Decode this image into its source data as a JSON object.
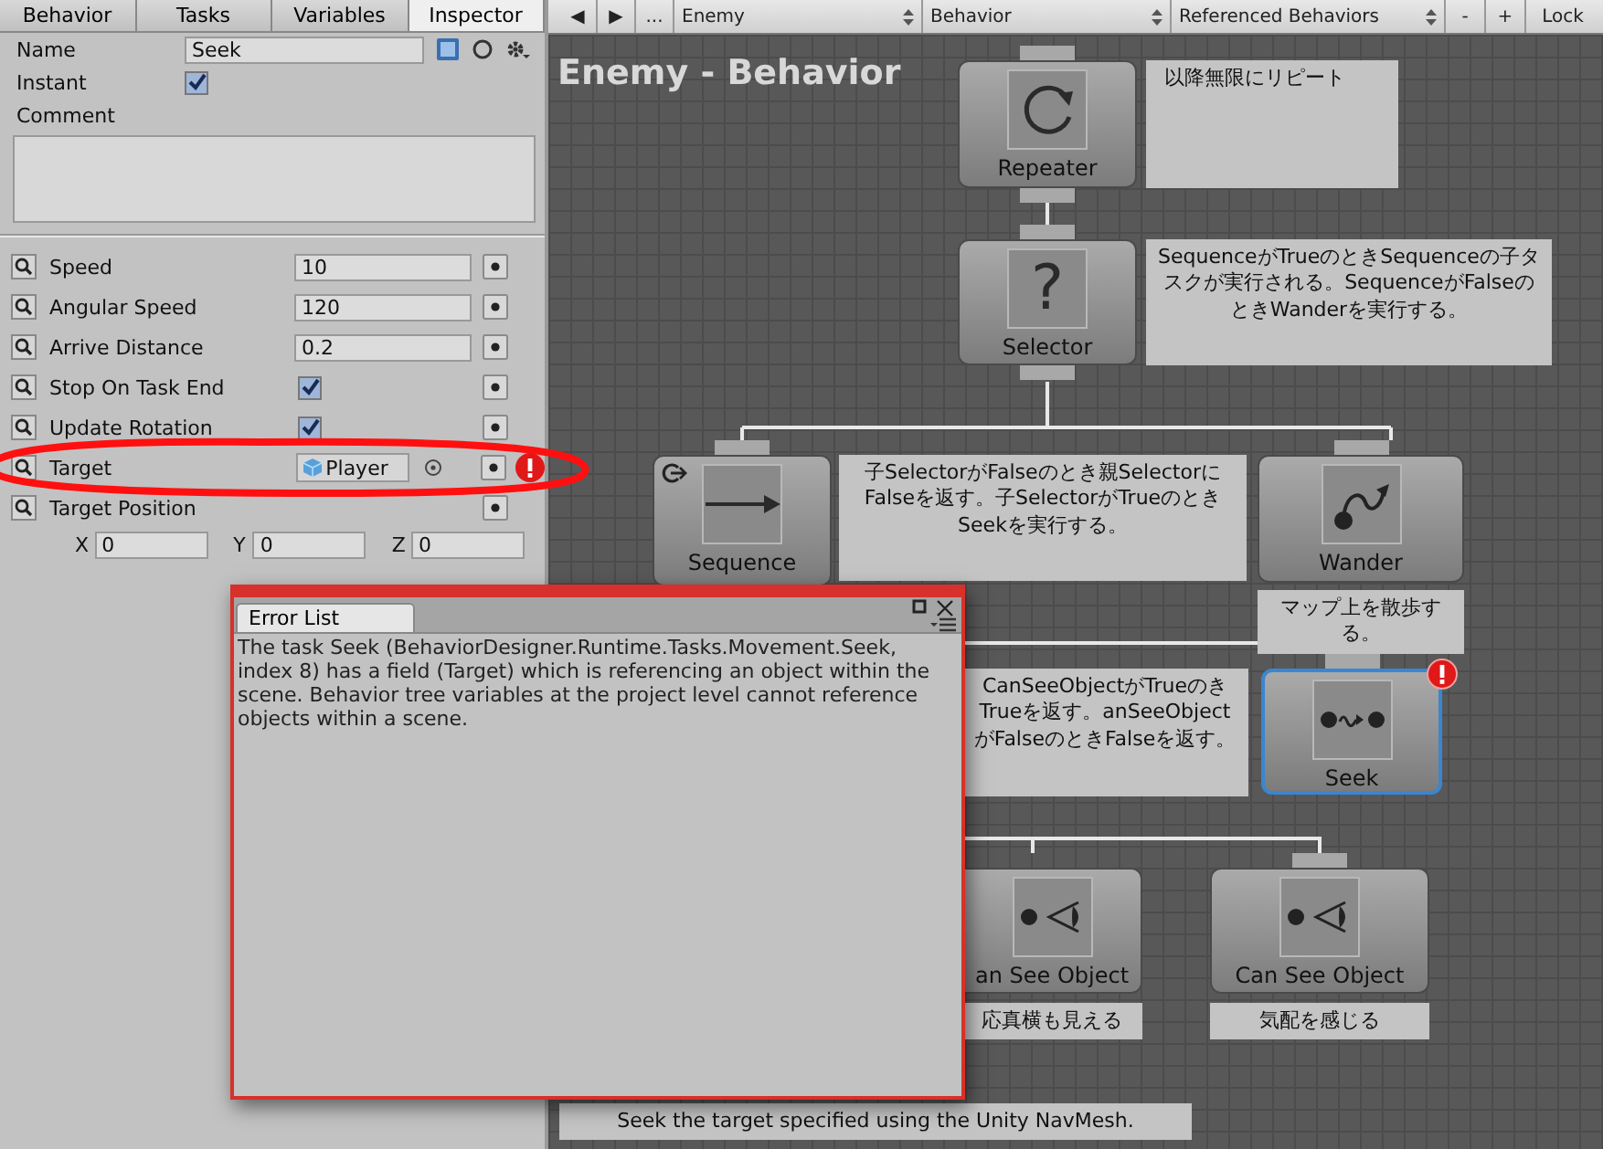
{
  "inspector_tabs": [
    {
      "label": "Behavior",
      "selected": false
    },
    {
      "label": "Tasks",
      "selected": false
    },
    {
      "label": "Variables",
      "selected": false
    },
    {
      "label": "Inspector",
      "selected": true
    }
  ],
  "task": {
    "name_label": "Name",
    "name": "Seek",
    "instant_label": "Instant",
    "instant": true,
    "comment_label": "Comment"
  },
  "fields": [
    {
      "kind": "text",
      "label": "Speed",
      "value": "10",
      "error": false
    },
    {
      "kind": "text",
      "label": "Angular Speed",
      "value": "120",
      "error": false
    },
    {
      "kind": "text",
      "label": "Arrive Distance",
      "value": "0.2",
      "error": false
    },
    {
      "kind": "checkbox",
      "label": "Stop On Task End",
      "checked": true,
      "error": false
    },
    {
      "kind": "checkbox",
      "label": "Update Rotation",
      "checked": true,
      "error": false
    },
    {
      "kind": "object",
      "label": "Target",
      "value": "Player",
      "error": true
    },
    {
      "kind": "vector",
      "label": "Target Position",
      "error": false,
      "components": [
        {
          "axis": "X",
          "value": "0"
        },
        {
          "axis": "Y",
          "value": "0"
        },
        {
          "axis": "Z",
          "value": "0"
        }
      ]
    }
  ],
  "annotation": {
    "kind": "ellipse"
  },
  "toolbar": {
    "nav": [
      "◀",
      "▶",
      "..."
    ],
    "dropdowns": [
      "Enemy",
      "Behavior",
      "Referenced Behaviors"
    ],
    "actions": [
      "-",
      "+",
      "Lock"
    ]
  },
  "canvas": {
    "title": "Enemy - Behavior",
    "nodes": [
      {
        "kind": "repeater",
        "label": "Repeater",
        "comment": "以降無限にリピート",
        "selected": false,
        "error": false
      },
      {
        "kind": "selector",
        "label": "Selector",
        "icon": "?",
        "comment": "SequenceがTrueのときSequenceの子タスクが実行される。SequenceがFalseのときWanderを実行する。",
        "selected": false,
        "error": false
      },
      {
        "kind": "sequence",
        "label": "Sequence",
        "comment": "子SelectorがFalseのとき親SelectorにFalseを返す。子SelectorがTrueのときSeekを実行する。",
        "selected": false,
        "error": false
      },
      {
        "kind": "wander",
        "label": "Wander",
        "comment": "マップ上を散歩する。",
        "selected": false,
        "error": false
      },
      {
        "kind": "seek",
        "label": "Seek",
        "selected": true,
        "error": true
      },
      {
        "kind": "can_see_object",
        "label": "an See Object",
        "comment": "応真横も見える",
        "selected": false,
        "error": false
      },
      {
        "kind": "can_see_object",
        "label": "Can See Object",
        "comment": "気配を感じる",
        "selected": false,
        "error": false
      }
    ],
    "notes": [
      "CanSeeObjectがTrueのきTrueを返す。anSeeObjectがFalseのときFalseを返す。",
      "Seek the target specified using the Unity NavMesh."
    ]
  },
  "error_window": {
    "tab": "Error List",
    "message": "The task Seek (BehaviorDesigner.Runtime.Tasks.Movement.Seek, index 8) has a field (Target) which is referencing an object within the scene. Behavior tree variables at the project level cannot reference objects within a scene."
  }
}
